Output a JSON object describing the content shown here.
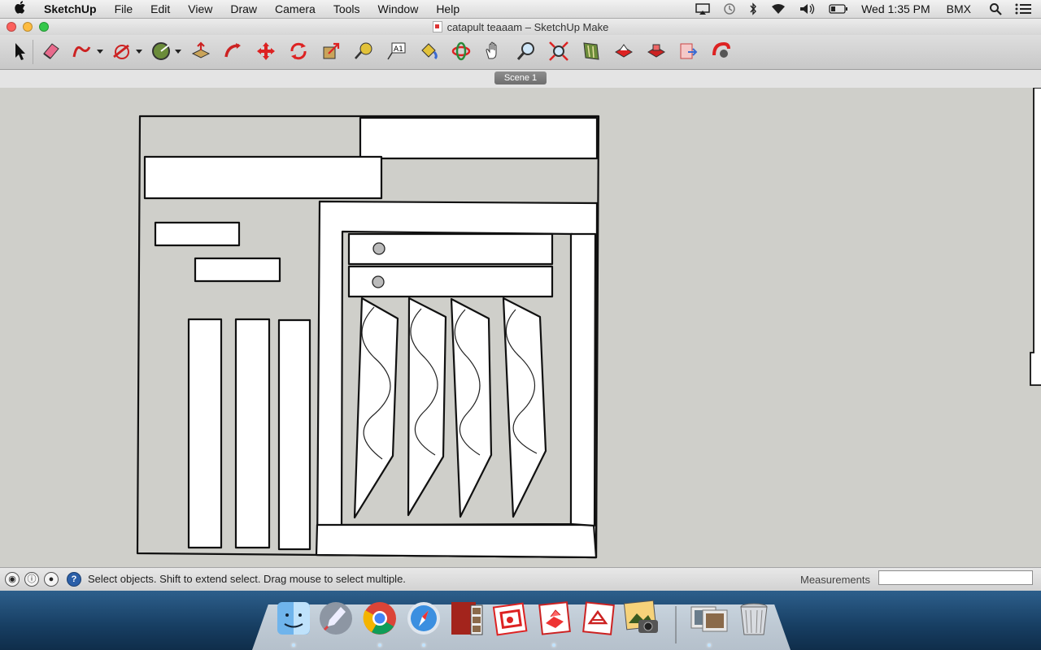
{
  "menubar": {
    "app_name": "SketchUp",
    "items": [
      "File",
      "Edit",
      "View",
      "Draw",
      "Camera",
      "Tools",
      "Window",
      "Help"
    ],
    "clock": "Wed 1:35 PM",
    "user": "BMX",
    "icons": [
      "airplay-icon",
      "time-machine-icon",
      "bluetooth-icon",
      "wifi-icon",
      "volume-icon",
      "battery-icon",
      "spotlight-icon",
      "notification-center-icon"
    ]
  },
  "window": {
    "title": "catapult teaaam – SketchUp Make",
    "scene_tab": "Scene 1"
  },
  "toolbar": {
    "tools": [
      "select-tool",
      "eraser-tool",
      "freehand-tool",
      "line-tool",
      "protractor-tool",
      "push-pull-tool",
      "follow-me-tool",
      "move-tool",
      "rotate-tool",
      "scale-tool",
      "tape-measure-tool",
      "text-tool",
      "paint-bucket-tool",
      "orbit-tool",
      "pan-tool",
      "zoom-tool",
      "zoom-extents-tool",
      "warehouse-tool",
      "share-model-tool",
      "extension-warehouse-tool",
      "send-to-layout-tool",
      "extension-manager-tool"
    ]
  },
  "statusbar": {
    "status_text": "Select objects. Shift to extend select. Drag mouse to select multiple.",
    "measurements_label": "Measurements",
    "measurements_value": ""
  },
  "dock": {
    "apps": [
      "finder-icon",
      "launchpad-icon",
      "chrome-icon",
      "safari-icon",
      "photo-booth-icon",
      "layout-icon",
      "sketchup-icon",
      "style-builder-icon",
      "iphoto-icon",
      "preview-icon",
      "trash-icon"
    ]
  },
  "colors": {
    "viewport_bg": "#cfcfca",
    "face": "#ffffff",
    "edge": "#111111"
  }
}
